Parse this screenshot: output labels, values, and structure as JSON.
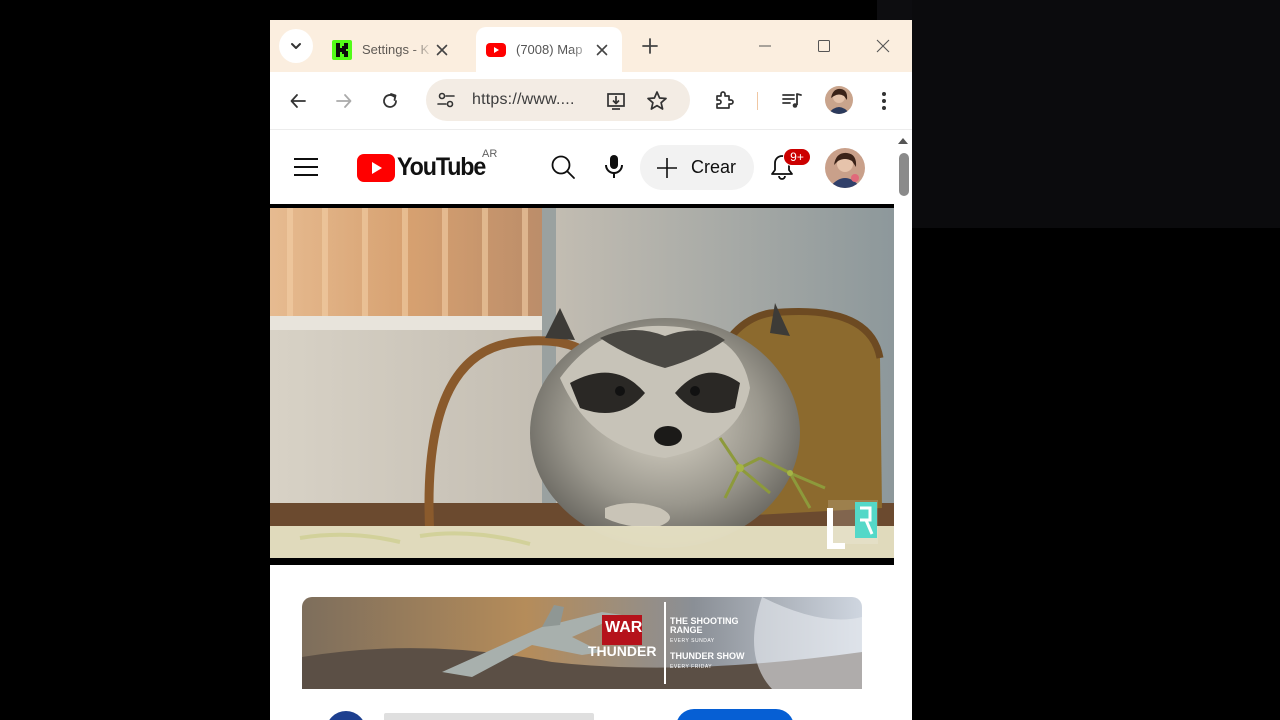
{
  "browser": {
    "tabs": [
      {
        "title": "Settings - K",
        "favicon": "kick-icon",
        "active": false
      },
      {
        "title": "(7008) Map",
        "favicon": "youtube-icon",
        "active": true
      }
    ],
    "url": "https://www....",
    "colors": {
      "tabstrip": "#fbeedf",
      "omnibox": "#f3ece4"
    }
  },
  "youtube": {
    "logo_text": "YouTube",
    "country_code": "AR",
    "create_label": "Crear",
    "notification_badge": "9+",
    "brand_color": "#ff0000"
  },
  "ad": {
    "brand_line1": "WAR",
    "brand_line2": "THUNDER",
    "show1_title": "THE SHOOTING RANGE",
    "show1_sub": "EVERY SUNDAY",
    "show2_title": "THUNDER SHOW",
    "show2_sub": "EVERY FRIDAY"
  }
}
